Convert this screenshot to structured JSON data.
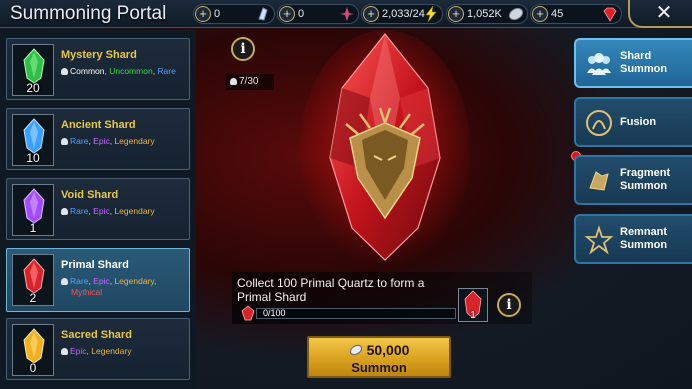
{
  "window": {
    "title": "Summoning Portal"
  },
  "resources": [
    {
      "value": "0",
      "icon": "hand-scroll-icon",
      "color": "#cfe0ff"
    },
    {
      "value": "0",
      "icon": "arena-token-icon",
      "color": "#d04a7a"
    },
    {
      "value": "2,033/24",
      "icon": "energy-bolt-icon",
      "color": "#f5e02a"
    },
    {
      "value": "1,052K",
      "icon": "silver-coin-icon",
      "color": "#cfd6de"
    },
    {
      "value": "45",
      "icon": "ruby-gem-icon",
      "color": "#e0202a"
    }
  ],
  "shards": [
    {
      "name": "Mystery Shard",
      "count": "20",
      "color": "#2fbf4a",
      "rarities": [
        {
          "text": "Common",
          "cls": "r-common"
        },
        {
          "text": "Uncommon",
          "cls": "r-uncommon"
        },
        {
          "text": "Rare",
          "cls": "r-rare"
        }
      ],
      "selected": false
    },
    {
      "name": "Ancient Shard",
      "count": "10",
      "color": "#3aa0ff",
      "rarities": [
        {
          "text": "Rare",
          "cls": "r-rare"
        },
        {
          "text": "Epic",
          "cls": "r-epic"
        },
        {
          "text": "Legendary",
          "cls": "r-legendary"
        }
      ],
      "selected": false
    },
    {
      "name": "Void Shard",
      "count": "1",
      "color": "#a24bff",
      "rarities": [
        {
          "text": "Rare",
          "cls": "r-rare"
        },
        {
          "text": "Epic",
          "cls": "r-epic"
        },
        {
          "text": "Legendary",
          "cls": "r-legendary"
        }
      ],
      "selected": false
    },
    {
      "name": "Primal Shard",
      "count": "2",
      "color": "#d8232a",
      "rarities": [
        {
          "text": "Rare",
          "cls": "r-rare"
        },
        {
          "text": "Epic",
          "cls": "r-epic"
        },
        {
          "text": "Legendary",
          "cls": "r-legendary"
        },
        {
          "text": "Mythical",
          "cls": "r-mythical"
        }
      ],
      "selected": true
    },
    {
      "name": "Sacred Shard",
      "count": "0",
      "color": "#f0b020",
      "rarities": [
        {
          "text": "Epic",
          "cls": "r-epic"
        },
        {
          "text": "Legendary",
          "cls": "r-legendary"
        }
      ],
      "selected": false
    }
  ],
  "pity": {
    "value": "7/30"
  },
  "primal": {
    "collect_text": "Collect 100 Primal Quartz to form a Primal Shard",
    "progress_text": "0/100",
    "progress_fraction": 0,
    "fragment_count": "1"
  },
  "summon": {
    "cost": "50,000",
    "label": "Summon"
  },
  "tabs": [
    {
      "label": "Shard Summon",
      "icon": "shard-summon-icon",
      "active": true
    },
    {
      "label": "Fusion",
      "icon": "fusion-icon",
      "active": false
    },
    {
      "label": "Fragment Summon",
      "icon": "fragment-summon-icon",
      "active": false,
      "notification": true
    },
    {
      "label": "Remnant Summon",
      "icon": "remnant-summon-icon",
      "active": false
    }
  ],
  "info": {
    "label": "i"
  },
  "close": {
    "label": "✕"
  }
}
